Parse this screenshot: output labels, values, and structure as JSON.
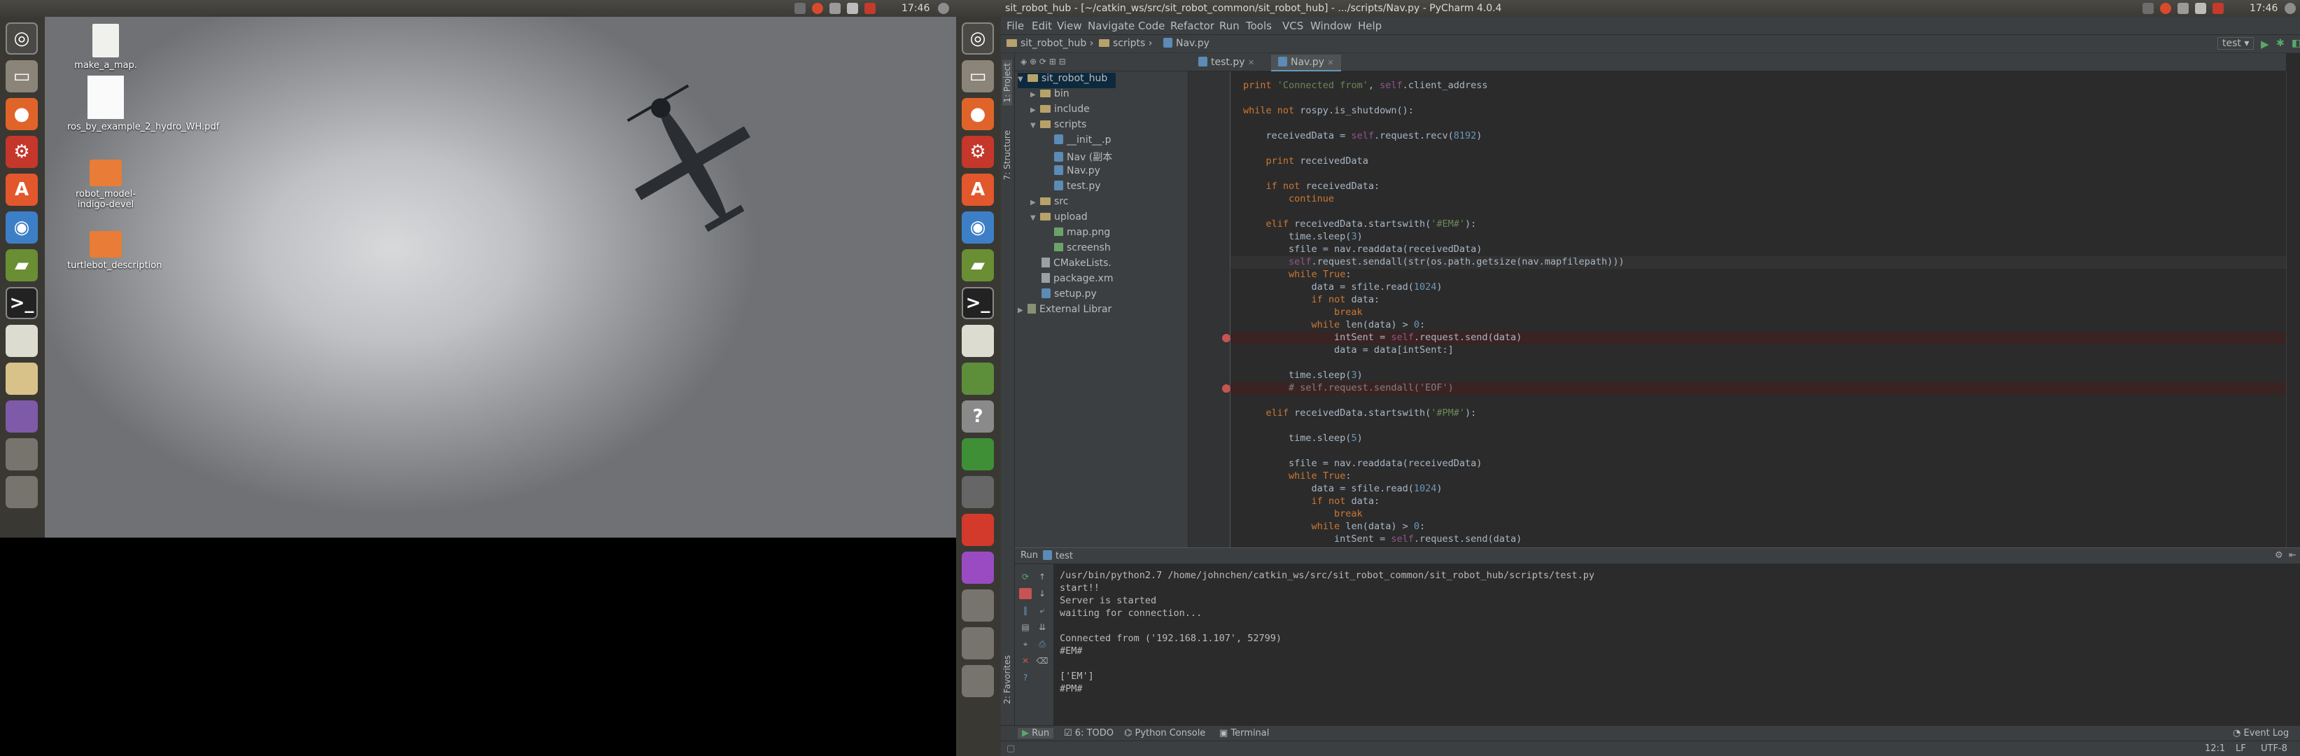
{
  "left_screen": {
    "time": "17:46",
    "desktop_icons": [
      {
        "label": "make_a_map.",
        "name": "make-a-map-file"
      },
      {
        "label": "ros_by_example_2_hydro_WH.pdf",
        "name": "ros-by-example-pdf"
      },
      {
        "label": "robot_model-indigo-devel",
        "name": "robot-model-folder"
      },
      {
        "label": "turtlebot_description",
        "name": "turtlebot-description-folder"
      }
    ],
    "file_thumb_text": "Tgit\nfmpt"
  },
  "right_screen": {
    "window_title": "sit_robot_hub - [~/catkin_ws/src/sit_robot_common/sit_robot_hub] - .../scripts/Nav.py - PyCharm 4.0.4",
    "time": "17:46",
    "menu": [
      "File",
      "Edit",
      "View",
      "Navigate",
      "Code",
      "Refactor",
      "Run",
      "Tools",
      "VCS",
      "Window",
      "Help"
    ],
    "breadcrumbs": [
      "sit_robot_hub",
      "scripts",
      "Nav.py"
    ],
    "run_config": "test",
    "project_tree": [
      {
        "label": "sit_robot_hub",
        "kind": "folder",
        "selected": true
      },
      {
        "label": "bin",
        "kind": "folder"
      },
      {
        "label": "include",
        "kind": "folder"
      },
      {
        "label": "scripts",
        "kind": "folder"
      },
      {
        "label": "__init__.p",
        "kind": "py"
      },
      {
        "label": "Nav (副本).",
        "kind": "py"
      },
      {
        "label": "Nav.py",
        "kind": "py"
      },
      {
        "label": "test.py",
        "kind": "py"
      },
      {
        "label": "src",
        "kind": "folder"
      },
      {
        "label": "upload",
        "kind": "folder"
      },
      {
        "label": "map.png",
        "kind": "img"
      },
      {
        "label": "screensh",
        "kind": "img"
      },
      {
        "label": "CMakeLists.",
        "kind": "txt"
      },
      {
        "label": "package.xm",
        "kind": "txt"
      },
      {
        "label": "setup.py",
        "kind": "py"
      },
      {
        "label": "External Librar",
        "kind": "lib"
      }
    ],
    "tabs": [
      {
        "label": "test.py"
      },
      {
        "label": "Nav.py"
      }
    ],
    "side_tabs": {
      "project": "1: Project",
      "structure": "7: Structure",
      "favorites": "2: Favorites"
    },
    "code": [
      "print 'Connected from', self.client_address",
      "",
      "while not rospy.is_shutdown():",
      "",
      "    receivedData = self.request.recv(8192)",
      "",
      "    print receivedData",
      "",
      "    if not receivedData:",
      "        continue",
      "",
      "    elif receivedData.startswith('#EM#'):",
      "        time.sleep(3)",
      "        sfile = nav.readdata(receivedData)",
      "        self.request.sendall(str(os.path.getsize(nav.mapfilepath)))",
      "        while True:",
      "            data = sfile.read(1024)",
      "            if not data:",
      "                break",
      "            while len(data) > 0:",
      "                intSent = self.request.send(data)",
      "                data = data[intSent:]",
      "",
      "        time.sleep(3)",
      "        # self.request.sendall('EOF')",
      "",
      "    elif receivedData.startswith('#PM#'):",
      "",
      "        time.sleep(5)",
      "",
      "        sfile = nav.readdata(receivedData)",
      "        while True:",
      "            data = sfile.read(1024)",
      "            if not data:",
      "                break",
      "            while len(data) > 0:",
      "                intSent = self.request.send(data)"
    ],
    "run_panel": {
      "title": "Run",
      "config": "test"
    },
    "console": [
      "/usr/bin/python2.7 /home/johnchen/catkin_ws/src/sit_robot_common/sit_robot_hub/scripts/test.py",
      "start!!",
      "Server is started",
      "waiting for connection...",
      "",
      "Connected from ('192.168.1.107', 52799)",
      "#EM#",
      "",
      "['EM']",
      "#PM#"
    ],
    "bottom_tabs": [
      "Run",
      "6: TODO",
      "Python Console",
      "Terminal"
    ],
    "event_log": "Event Log",
    "status": {
      "position": "12:1",
      "line_sep": "LF",
      "encoding": "UTF-8"
    },
    "breakpoint_color": "#c75450",
    "accent": "#6897bb"
  }
}
